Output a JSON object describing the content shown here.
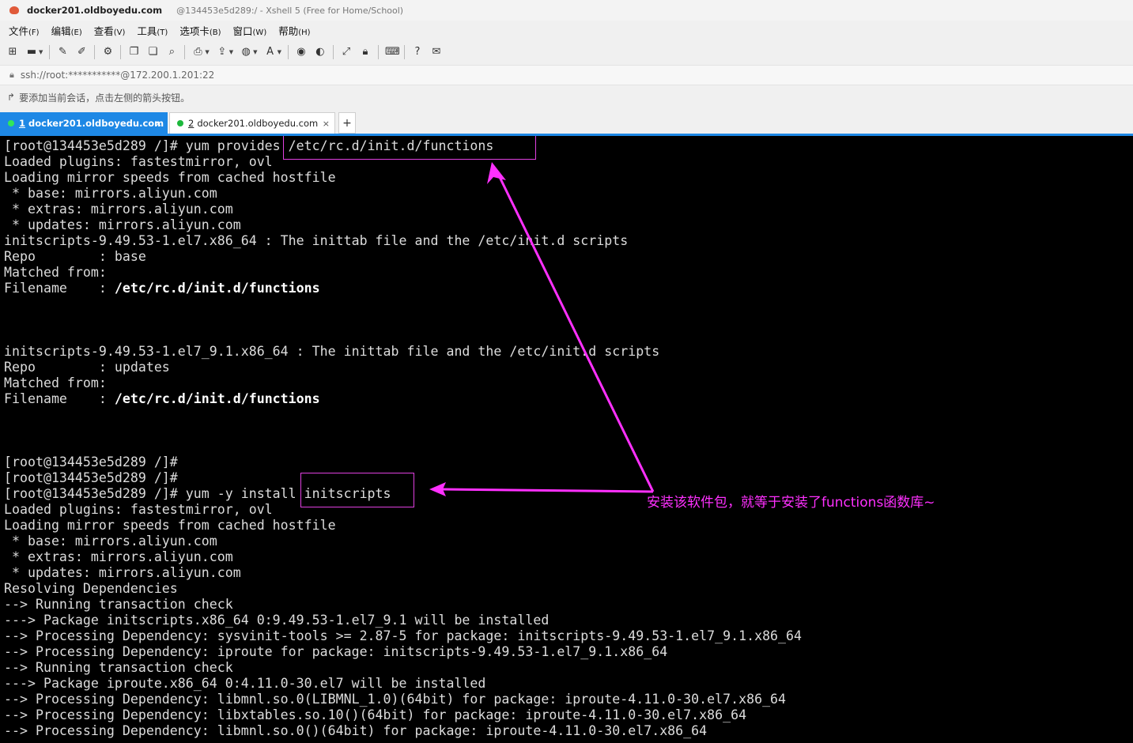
{
  "window": {
    "title_main": "docker201.oldboyedu.com",
    "title_sub": "@134453e5d289:/ - Xshell 5 (Free for Home/School)"
  },
  "menu": [
    {
      "label": "文件",
      "key": "(F)"
    },
    {
      "label": "编辑",
      "key": "(E)"
    },
    {
      "label": "查看",
      "key": "(V)"
    },
    {
      "label": "工具",
      "key": "(T)"
    },
    {
      "label": "选项卡",
      "key": "(B)"
    },
    {
      "label": "窗口",
      "key": "(W)"
    },
    {
      "label": "帮助",
      "key": "(H)"
    }
  ],
  "address": {
    "value": "ssh://root:***********@172.200.1.201:22"
  },
  "hint": {
    "text": "要添加当前会话，点击左侧的箭头按钮。"
  },
  "tabs": [
    {
      "num": "1",
      "label": "docker201.oldboyedu.com",
      "close": "×",
      "active": true
    },
    {
      "num": "2",
      "label": "docker201.oldboyedu.com",
      "close": "×",
      "active": false
    }
  ],
  "tab_add": "+",
  "terminal": {
    "lines": [
      {
        "text": "[root@134453e5d289 /]# yum provides /etc/rc.d/init.d/functions"
      },
      {
        "text": "Loaded plugins: fastestmirror, ovl"
      },
      {
        "text": "Loading mirror speeds from cached hostfile"
      },
      {
        "text": " * base: mirrors.aliyun.com"
      },
      {
        "text": " * extras: mirrors.aliyun.com"
      },
      {
        "text": " * updates: mirrors.aliyun.com"
      },
      {
        "text": "initscripts-9.49.53-1.el7.x86_64 : The inittab file and the /etc/init.d scripts"
      },
      {
        "text": "Repo        : base"
      },
      {
        "text": "Matched from:"
      },
      {
        "prefix": "Filename    : ",
        "bold": "/etc/rc.d/init.d/functions"
      },
      {
        "text": ""
      },
      {
        "text": ""
      },
      {
        "text": ""
      },
      {
        "text": "initscripts-9.49.53-1.el7_9.1.x86_64 : The inittab file and the /etc/init.d scripts"
      },
      {
        "text": "Repo        : updates"
      },
      {
        "text": "Matched from:"
      },
      {
        "prefix": "Filename    : ",
        "bold": "/etc/rc.d/init.d/functions"
      },
      {
        "text": ""
      },
      {
        "text": ""
      },
      {
        "text": ""
      },
      {
        "text": "[root@134453e5d289 /]#"
      },
      {
        "text": "[root@134453e5d289 /]#"
      },
      {
        "text": "[root@134453e5d289 /]# yum -y install initscripts"
      },
      {
        "text": "Loaded plugins: fastestmirror, ovl"
      },
      {
        "text": "Loading mirror speeds from cached hostfile"
      },
      {
        "text": " * base: mirrors.aliyun.com"
      },
      {
        "text": " * extras: mirrors.aliyun.com"
      },
      {
        "text": " * updates: mirrors.aliyun.com"
      },
      {
        "text": "Resolving Dependencies"
      },
      {
        "text": "--> Running transaction check"
      },
      {
        "text": "---> Package initscripts.x86_64 0:9.49.53-1.el7_9.1 will be installed"
      },
      {
        "text": "--> Processing Dependency: sysvinit-tools >= 2.87-5 for package: initscripts-9.49.53-1.el7_9.1.x86_64"
      },
      {
        "text": "--> Processing Dependency: iproute for package: initscripts-9.49.53-1.el7_9.1.x86_64"
      },
      {
        "text": "--> Running transaction check"
      },
      {
        "text": "---> Package iproute.x86_64 0:4.11.0-30.el7 will be installed"
      },
      {
        "text": "--> Processing Dependency: libmnl.so.0(LIBMNL_1.0)(64bit) for package: iproute-4.11.0-30.el7.x86_64"
      },
      {
        "text": "--> Processing Dependency: libxtables.so.10()(64bit) for package: iproute-4.11.0-30.el7.x86_64"
      },
      {
        "text": "--> Processing Dependency: libmnl.so.0()(64bit) for package: iproute-4.11.0-30.el7.x86_64"
      }
    ]
  },
  "annotation": {
    "text": "安装该软件包，就等于安装了functions函数库~",
    "color": "#ff30ff"
  },
  "colors": {
    "tab_active": "#1e88e5",
    "terminal_bg": "#000000",
    "terminal_fg": "#dcdcdc",
    "highlight": "#e040e0"
  }
}
